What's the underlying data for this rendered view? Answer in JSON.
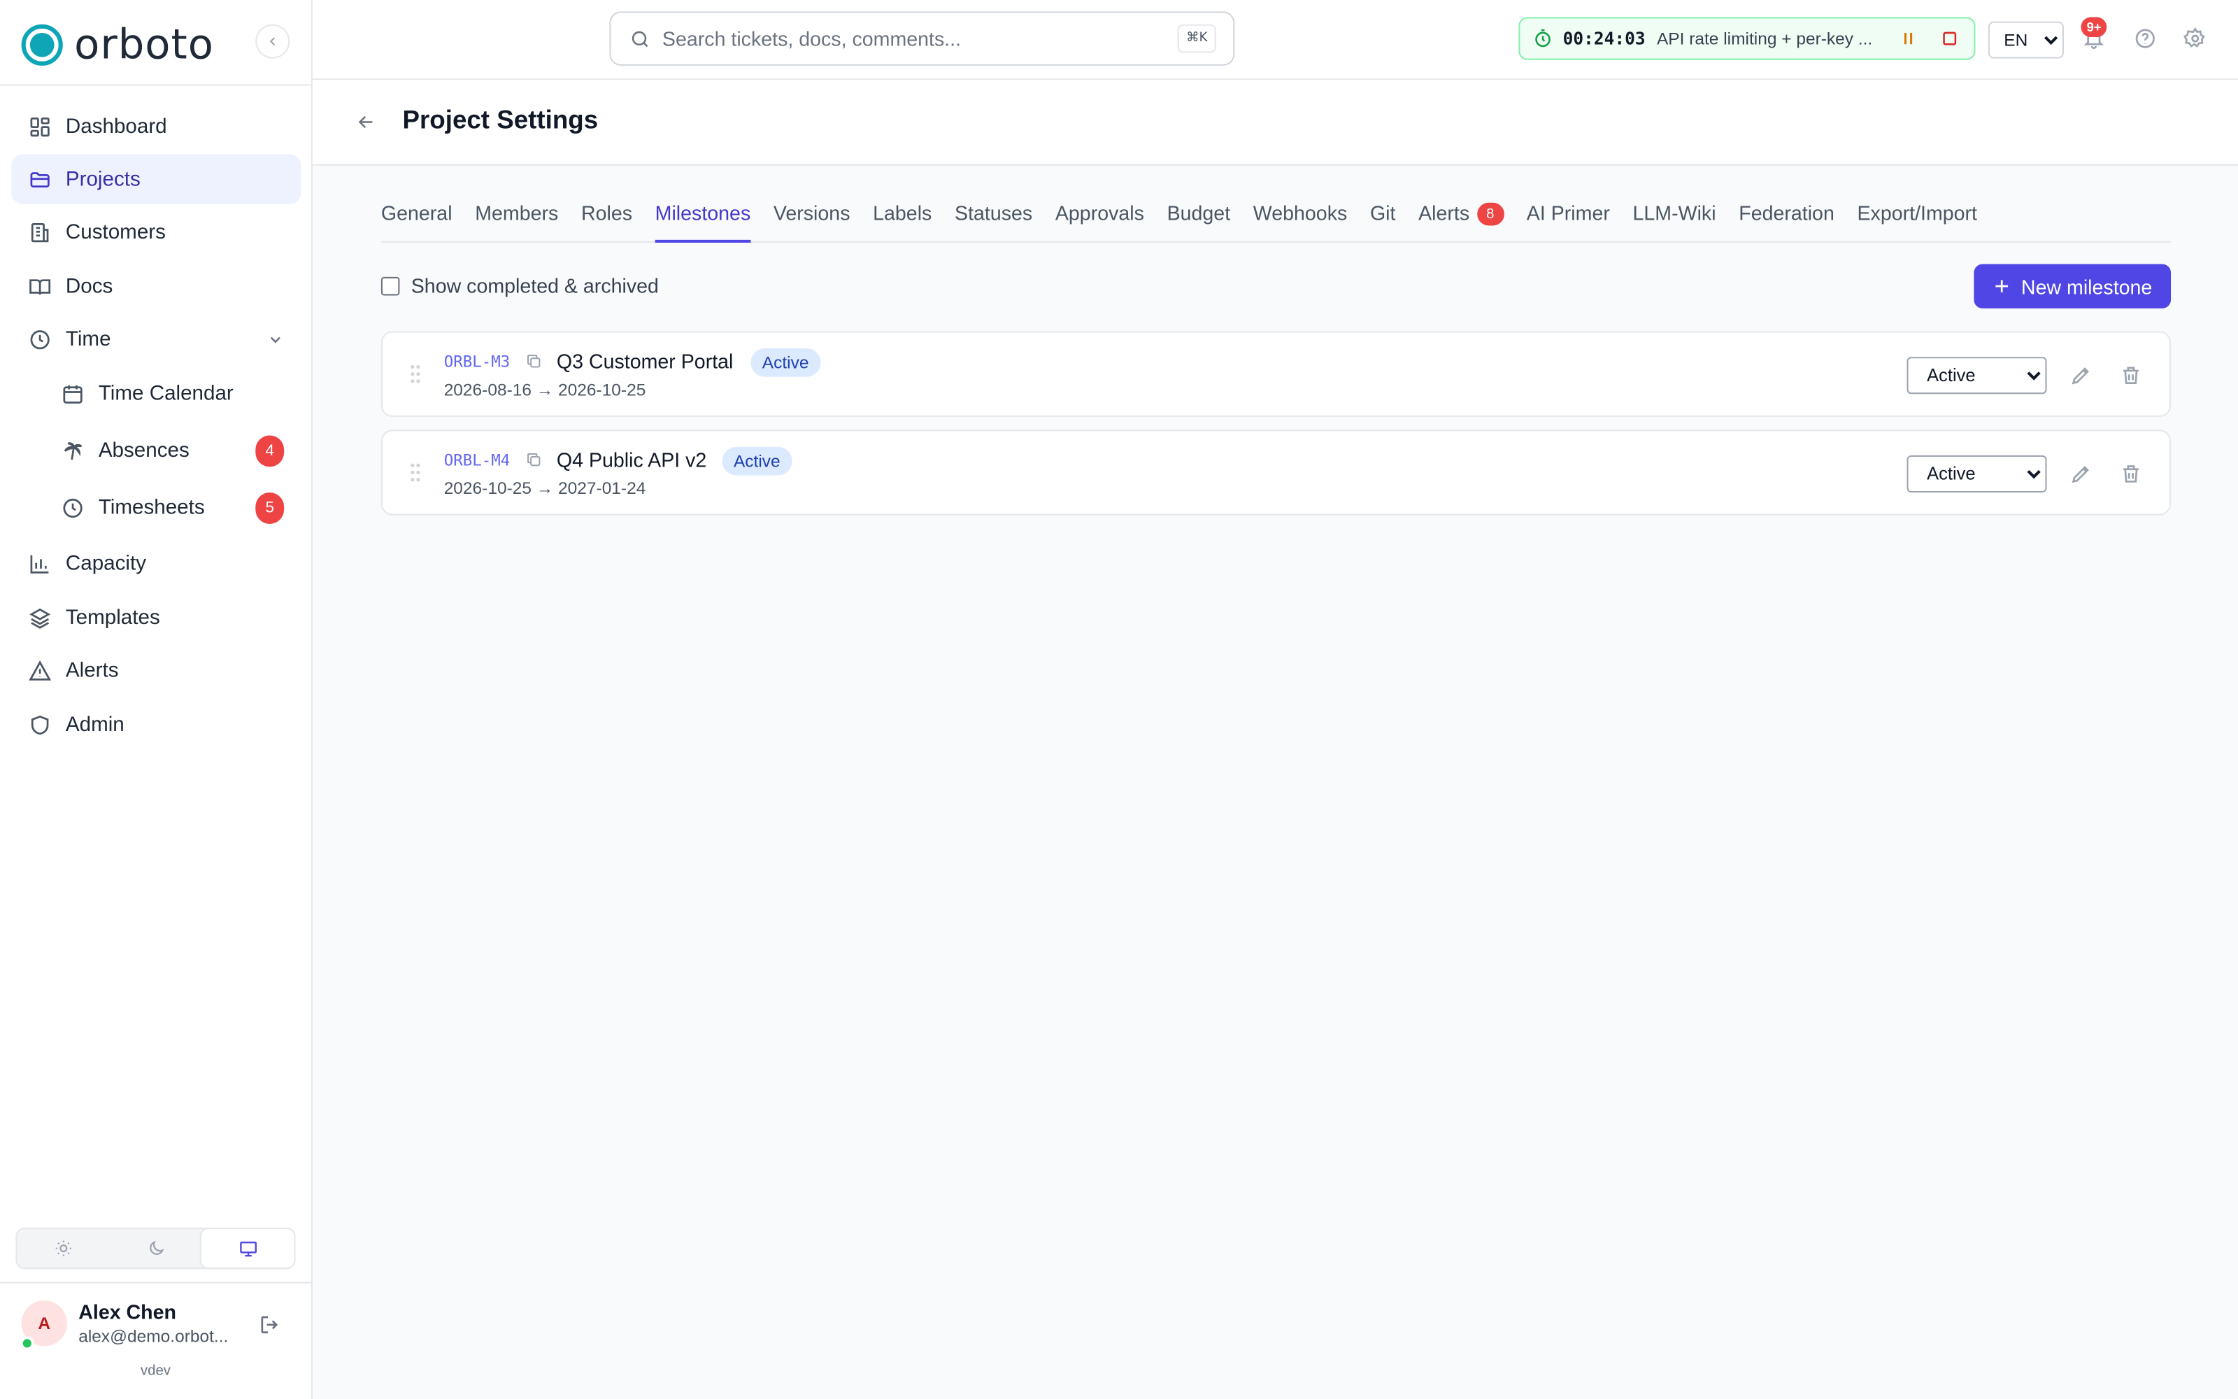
{
  "brand": {
    "name": "orboto"
  },
  "sidebar": {
    "items": [
      {
        "label": "Dashboard",
        "icon": "dashboard-icon"
      },
      {
        "label": "Projects",
        "icon": "folder-icon",
        "active": true
      },
      {
        "label": "Customers",
        "icon": "building-icon"
      },
      {
        "label": "Docs",
        "icon": "book-icon"
      },
      {
        "label": "Time",
        "icon": "clock-icon",
        "expanded": true
      },
      {
        "label": "Time Calendar",
        "icon": "calendar-icon",
        "sub": true
      },
      {
        "label": "Absences",
        "icon": "palm-tree-icon",
        "sub": true,
        "badge": "4"
      },
      {
        "label": "Timesheets",
        "icon": "clock-icon",
        "sub": true,
        "badge": "5"
      },
      {
        "label": "Capacity",
        "icon": "bar-chart-icon"
      },
      {
        "label": "Templates",
        "icon": "layers-icon"
      },
      {
        "label": "Alerts",
        "icon": "warning-icon"
      },
      {
        "label": "Admin",
        "icon": "shield-icon"
      }
    ],
    "theme": {
      "selected": "system"
    },
    "user": {
      "initial": "A",
      "name": "Alex Chen",
      "email": "alex@demo.orbot..."
    },
    "version": "vdev"
  },
  "topbar": {
    "search": {
      "placeholder": "Search tickets, docs, comments...",
      "shortcut": "⌘K"
    },
    "timer": {
      "time": "00:24:03",
      "task": "API rate limiting + per-key ..."
    },
    "language": "EN",
    "notifications_badge": "9+"
  },
  "page": {
    "title": "Project Settings",
    "tabs": [
      {
        "label": "General"
      },
      {
        "label": "Members"
      },
      {
        "label": "Roles"
      },
      {
        "label": "Milestones",
        "active": true
      },
      {
        "label": "Versions"
      },
      {
        "label": "Labels"
      },
      {
        "label": "Statuses"
      },
      {
        "label": "Approvals"
      },
      {
        "label": "Budget"
      },
      {
        "label": "Webhooks"
      },
      {
        "label": "Git"
      },
      {
        "label": "Alerts",
        "badge": "8"
      },
      {
        "label": "AI Primer"
      },
      {
        "label": "LLM-Wiki"
      },
      {
        "label": "Federation"
      },
      {
        "label": "Export/Import"
      }
    ],
    "show_completed_label": "Show completed & archived",
    "new_milestone_label": "New milestone",
    "milestones": [
      {
        "key": "ORBL-M3",
        "name": "Q3 Customer Portal",
        "status": "Active",
        "dates": "2026-08-16 → 2026-10-25",
        "select_value": "Active"
      },
      {
        "key": "ORBL-M4",
        "name": "Q4 Public API v2",
        "status": "Active",
        "dates": "2026-10-25 → 2027-01-24",
        "select_value": "Active"
      }
    ]
  },
  "colors": {
    "accent": "#4f46e5",
    "brand": "#0ea5b7",
    "danger": "#ef4444",
    "timer_bg": "#f0fdf4"
  }
}
